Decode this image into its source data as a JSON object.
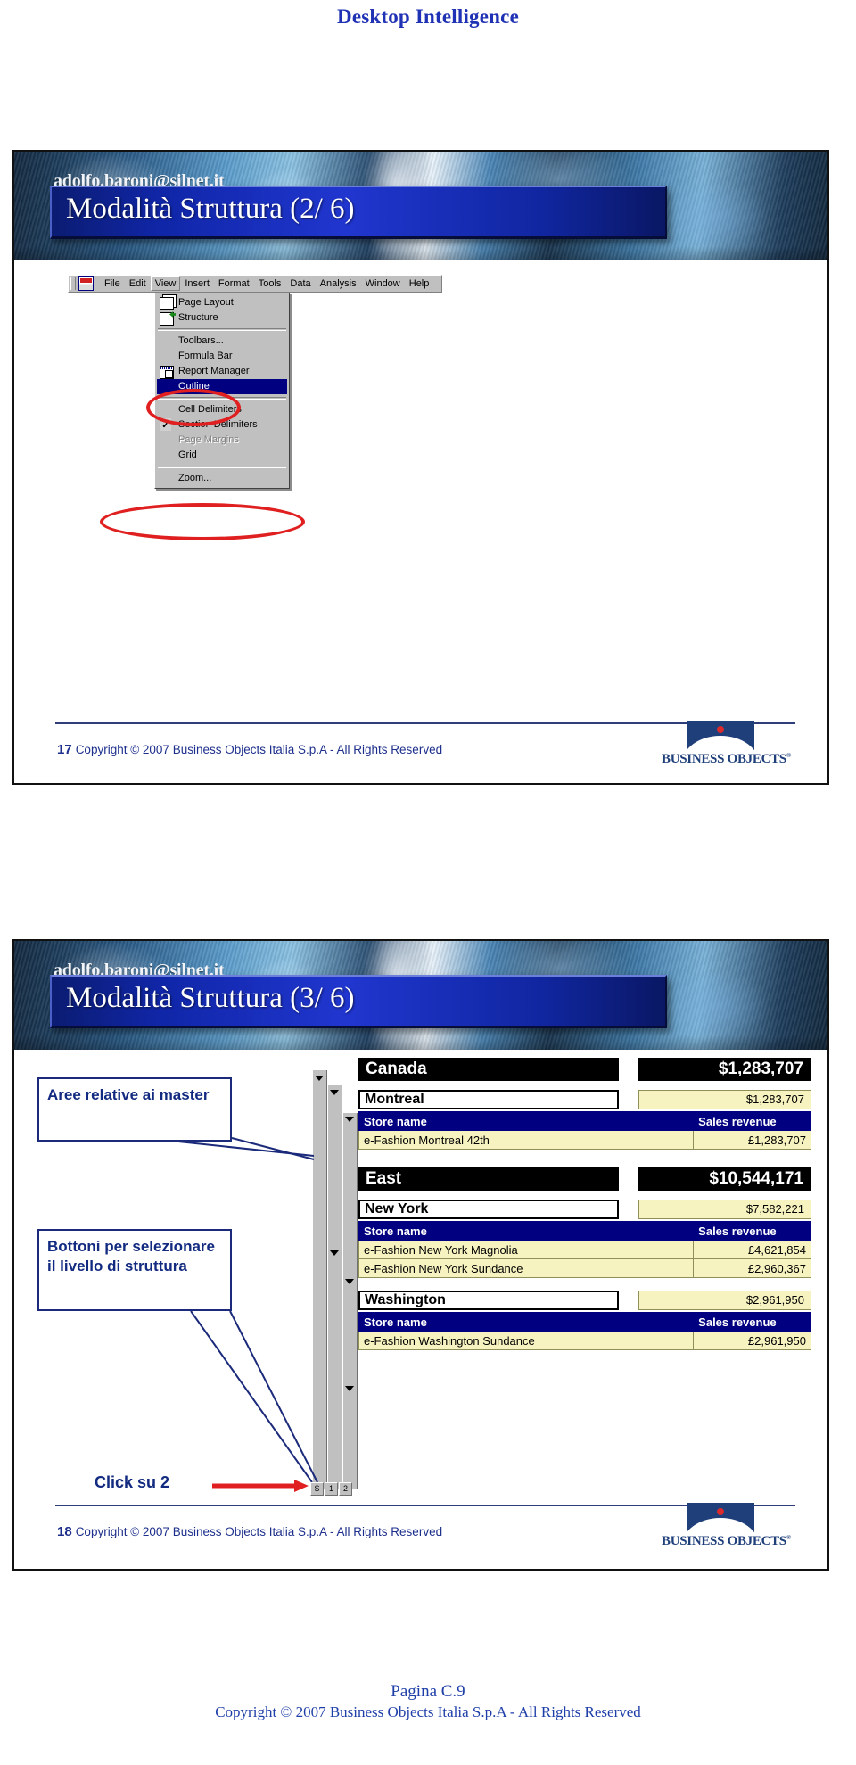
{
  "document": {
    "title": "Desktop Intelligence",
    "footer_page": "Pagina C.9",
    "footer_copyright": "Copyright © 2007 Business Objects Italia S.p.A  - All Rights Reserved"
  },
  "brand": {
    "logo_word": "BUSINESS OBJECTS",
    "logo_tm": "®",
    "accent_blue": "#1f3f7a",
    "accent_red": "#d92b2b",
    "title_blue": "#1f31b4"
  },
  "slides": [
    {
      "number": "17",
      "email": "adolfo.baroni@silnet.it",
      "title": "Modalità Struttura (2/ 6)",
      "footer_copyright": "Copyright © 2007 Business Objects Italia S.p.A - All Rights Reserved"
    },
    {
      "number": "18",
      "email": "adolfo.baroni@silnet.it",
      "title": "Modalità Struttura (3/ 6)",
      "footer_copyright": "Copyright © 2007 Business Objects Italia S.p.A - All Rights Reserved"
    }
  ],
  "menu_screenshot": {
    "menubar": [
      {
        "label": "File",
        "accel": "F",
        "active": false
      },
      {
        "label": "Edit",
        "accel": "E",
        "active": false
      },
      {
        "label": "View",
        "accel": "V",
        "active": true
      },
      {
        "label": "Insert",
        "accel": "s",
        "active": false
      },
      {
        "label": "Format",
        "accel": "o",
        "active": false
      },
      {
        "label": "Tools",
        "accel": "T",
        "active": false
      },
      {
        "label": "Data",
        "accel": "D",
        "active": false
      },
      {
        "label": "Analysis",
        "accel": "A",
        "active": false
      },
      {
        "label": "Window",
        "accel": "W",
        "active": false
      },
      {
        "label": "Help",
        "accel": "H",
        "active": false
      }
    ],
    "dropdown": [
      {
        "type": "item",
        "label": "Page Layout",
        "icon": "page-layout-icon",
        "selected": false,
        "disabled": false,
        "checked": false
      },
      {
        "type": "item",
        "label": "Structure",
        "icon": "structure-icon",
        "selected": false,
        "disabled": false,
        "checked": false
      },
      {
        "type": "separator"
      },
      {
        "type": "item",
        "label": "Toolbars...",
        "icon": "",
        "selected": false,
        "disabled": false,
        "checked": false
      },
      {
        "type": "item",
        "label": "Formula Bar",
        "icon": "",
        "selected": false,
        "disabled": false,
        "checked": false
      },
      {
        "type": "item",
        "label": "Report Manager",
        "icon": "report-manager-icon",
        "selected": false,
        "disabled": false,
        "checked": false
      },
      {
        "type": "item",
        "label": "Outline",
        "icon": "",
        "selected": true,
        "disabled": false,
        "checked": false
      },
      {
        "type": "separator"
      },
      {
        "type": "item",
        "label": "Cell Delimiters",
        "icon": "",
        "selected": false,
        "disabled": false,
        "checked": false
      },
      {
        "type": "item",
        "label": "Section Delimiters",
        "icon": "",
        "selected": false,
        "disabled": false,
        "checked": true
      },
      {
        "type": "item",
        "label": "Page Margins",
        "icon": "",
        "selected": false,
        "disabled": true,
        "checked": false
      },
      {
        "type": "item",
        "label": "Grid",
        "icon": "",
        "selected": false,
        "disabled": false,
        "checked": false
      },
      {
        "type": "separator"
      },
      {
        "type": "item",
        "label": "Zoom...",
        "icon": "",
        "selected": false,
        "disabled": false,
        "checked": false
      }
    ],
    "highlights": [
      {
        "name": "view-menu-highlight",
        "shape": "ellipse",
        "color": "#e02020"
      },
      {
        "name": "outline-item-highlight",
        "shape": "ellipse",
        "color": "#e02020"
      }
    ]
  },
  "annotations": {
    "callout_master": "Aree relative ai master",
    "callout_buttons": "Bottoni per selezionare il livello di struttura",
    "click_label": "Click su 2"
  },
  "report": {
    "column_headers": {
      "store": "Store name",
      "revenue": "Sales revenue"
    },
    "outline_level_buttons": [
      "S",
      "1",
      "2"
    ],
    "sections": [
      {
        "region": "Canada",
        "region_total": "$1,283,707",
        "cities": [
          {
            "city": "Montreal",
            "city_total": "$1,283,707",
            "rows": [
              {
                "store": "e-Fashion Montreal  42th",
                "revenue": "£1,283,707"
              }
            ]
          }
        ]
      },
      {
        "region": "East",
        "region_total": "$10,544,171",
        "cities": [
          {
            "city": "New York",
            "city_total": "$7,582,221",
            "rows": [
              {
                "store": "e-Fashion New York  Magnolia",
                "revenue": "£4,621,854"
              },
              {
                "store": "e-Fashion New York  Sundance",
                "revenue": "£2,960,367"
              }
            ]
          },
          {
            "city": "Washington",
            "city_total": "$2,961,950",
            "rows": [
              {
                "store": "e-Fashion Washington  Sundance",
                "revenue": "£2,961,950"
              }
            ]
          }
        ]
      }
    ]
  }
}
